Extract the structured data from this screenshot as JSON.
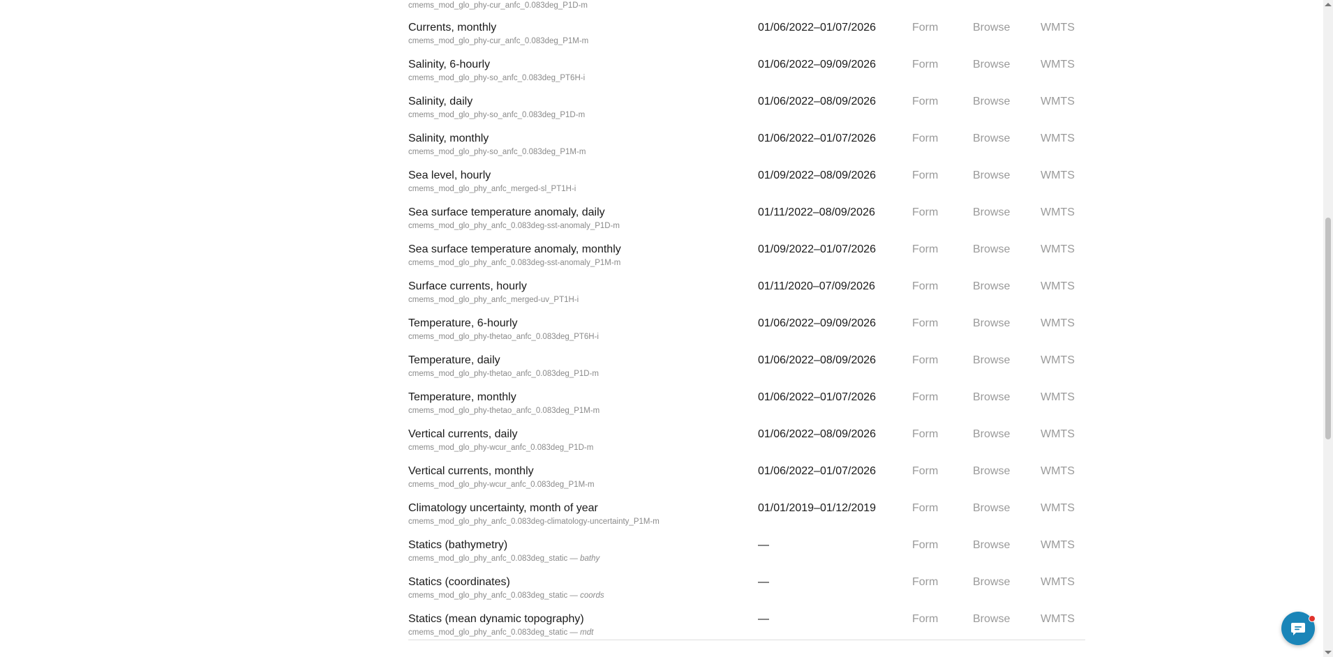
{
  "links": {
    "form": "Form",
    "browse": "Browse",
    "wmts": "WMTS"
  },
  "rows": [
    {
      "name": "",
      "id": "cmems_mod_glo_phy-cur_anfc_0.083deg_P1D-m",
      "suffix": "",
      "dates": ""
    },
    {
      "name": "Currents, monthly",
      "id": "cmems_mod_glo_phy-cur_anfc_0.083deg_P1M-m",
      "suffix": "",
      "dates": "01/06/2022–01/07/2026"
    },
    {
      "name": "Salinity, 6-hourly",
      "id": "cmems_mod_glo_phy-so_anfc_0.083deg_PT6H-i",
      "suffix": "",
      "dates": "01/06/2022–09/09/2026"
    },
    {
      "name": "Salinity, daily",
      "id": "cmems_mod_glo_phy-so_anfc_0.083deg_P1D-m",
      "suffix": "",
      "dates": "01/06/2022–08/09/2026"
    },
    {
      "name": "Salinity, monthly",
      "id": "cmems_mod_glo_phy-so_anfc_0.083deg_P1M-m",
      "suffix": "",
      "dates": "01/06/2022–01/07/2026"
    },
    {
      "name": "Sea level, hourly",
      "id": "cmems_mod_glo_phy_anfc_merged-sl_PT1H-i",
      "suffix": "",
      "dates": "01/09/2022–08/09/2026"
    },
    {
      "name": "Sea surface temperature anomaly, daily",
      "id": "cmems_mod_glo_phy_anfc_0.083deg-sst-anomaly_P1D-m",
      "suffix": "",
      "dates": "01/11/2022–08/09/2026"
    },
    {
      "name": "Sea surface temperature anomaly, monthly",
      "id": "cmems_mod_glo_phy_anfc_0.083deg-sst-anomaly_P1M-m",
      "suffix": "",
      "dates": "01/09/2022–01/07/2026"
    },
    {
      "name": "Surface currents, hourly",
      "id": "cmems_mod_glo_phy_anfc_merged-uv_PT1H-i",
      "suffix": "",
      "dates": "01/11/2020–07/09/2026"
    },
    {
      "name": "Temperature, 6-hourly",
      "id": "cmems_mod_glo_phy-thetao_anfc_0.083deg_PT6H-i",
      "suffix": "",
      "dates": "01/06/2022–09/09/2026"
    },
    {
      "name": "Temperature, daily",
      "id": "cmems_mod_glo_phy-thetao_anfc_0.083deg_P1D-m",
      "suffix": "",
      "dates": "01/06/2022–08/09/2026"
    },
    {
      "name": "Temperature, monthly",
      "id": "cmems_mod_glo_phy-thetao_anfc_0.083deg_P1M-m",
      "suffix": "",
      "dates": "01/06/2022–01/07/2026"
    },
    {
      "name": "Vertical currents, daily",
      "id": "cmems_mod_glo_phy-wcur_anfc_0.083deg_P1D-m",
      "suffix": "",
      "dates": "01/06/2022–08/09/2026"
    },
    {
      "name": "Vertical currents, monthly",
      "id": "cmems_mod_glo_phy-wcur_anfc_0.083deg_P1M-m",
      "suffix": "",
      "dates": "01/06/2022–01/07/2026"
    },
    {
      "name": "Climatology uncertainty, month of year",
      "id": "cmems_mod_glo_phy_anfc_0.083deg-climatology-uncertainty_P1M-m",
      "suffix": "",
      "dates": "01/01/2019–01/12/2019"
    },
    {
      "name": "Statics (bathymetry)",
      "id": "cmems_mod_glo_phy_anfc_0.083deg_static — ",
      "suffix": "bathy",
      "dates": "—"
    },
    {
      "name": "Statics (coordinates)",
      "id": "cmems_mod_glo_phy_anfc_0.083deg_static — ",
      "suffix": "coords",
      "dates": "—"
    },
    {
      "name": "Statics (mean dynamic topography)",
      "id": "cmems_mod_glo_phy_anfc_0.083deg_static — ",
      "suffix": "mdt",
      "dates": "—"
    }
  ],
  "colors": {
    "chat": "#1a85b8",
    "notification": "#e0332c",
    "link": "#9a9a9a"
  },
  "icons": {
    "chat": "chat-bubble-icon"
  }
}
